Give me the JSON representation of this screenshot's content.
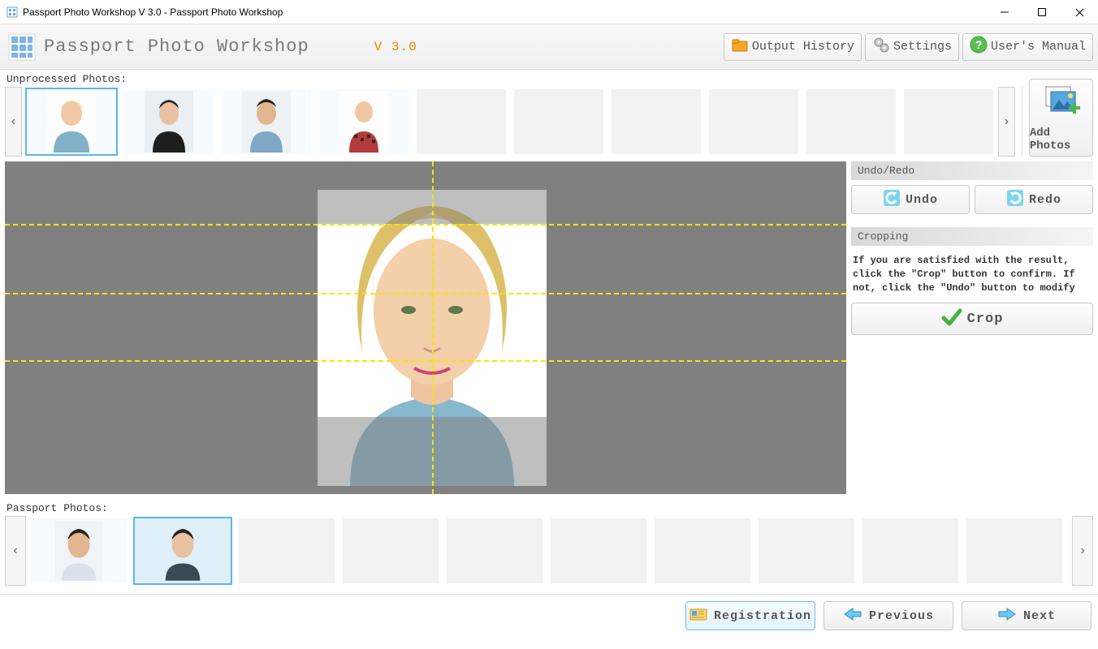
{
  "window": {
    "title": "Passport Photo Workshop V 3.0 - Passport Photo Workshop"
  },
  "header": {
    "brand": "Passport Photo Workshop",
    "version": "V 3.0",
    "buttons": {
      "history": "Output History",
      "settings": "Settings",
      "manual": "User's Manual"
    }
  },
  "strip_top": {
    "label": "Unprocessed Photos:"
  },
  "add_photos_label": "Add Photos",
  "right": {
    "undo_redo_title": "Undo/Redo",
    "undo": "Undo",
    "redo": "Redo",
    "cropping_title": "Cropping",
    "instructions": "If you are satisfied with the result, click the \"Crop\" button to confirm. If not, click the \"Undo\" button to modify",
    "crop": "Crop"
  },
  "strip_bottom": {
    "label": "Passport Photos:"
  },
  "footer": {
    "registration": "Registration",
    "previous": "Previous",
    "next": "Next"
  }
}
